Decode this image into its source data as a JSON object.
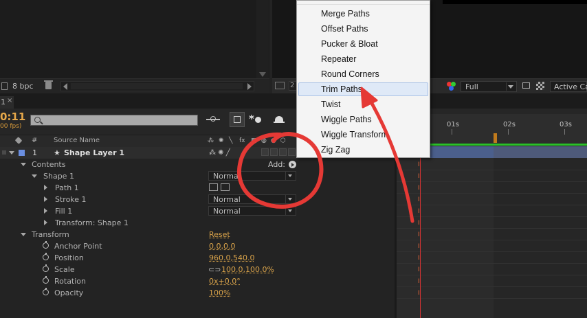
{
  "project": {
    "bpc_label": "8 bpc"
  },
  "viewer": {
    "zoom_label": "2",
    "resolution": "Full",
    "camera": "Active Cam"
  },
  "timeline": {
    "tab_label": "1",
    "timecode": "0:11",
    "fps": "00 fps)",
    "search_placeholder": "",
    "columns": {
      "number": "#",
      "source_name": "Source Name"
    },
    "ruler_ticks": [
      "01s",
      "02s",
      "03s"
    ]
  },
  "layers": {
    "shape_layer": {
      "number": "1",
      "name": "Shape Layer 1"
    },
    "contents_label": "Contents",
    "add_label": "Add:",
    "shape_group": {
      "label": "Shape 1",
      "mode": "Normal"
    },
    "path": {
      "label": "Path 1"
    },
    "stroke": {
      "label": "Stroke 1",
      "mode": "Normal"
    },
    "fill": {
      "label": "Fill 1",
      "mode": "Normal"
    },
    "transform_shape": {
      "label": "Transform: Shape 1"
    },
    "transform": {
      "label": "Transform",
      "reset": "Reset"
    },
    "properties": [
      {
        "label": "Anchor Point",
        "value": "0.0,0.0"
      },
      {
        "label": "Position",
        "value": "960.0,540.0"
      },
      {
        "label": "Scale",
        "value": "100.0,100.0%"
      },
      {
        "label": "Rotation",
        "value": "0x+0.0°"
      },
      {
        "label": "Opacity",
        "value": "100%"
      }
    ]
  },
  "add_menu": {
    "items": [
      "Merge Paths",
      "Offset Paths",
      "Pucker & Bloat",
      "Repeater",
      "Round Corners",
      "Trim Paths",
      "Twist",
      "Wiggle Paths",
      "Wiggle Transform",
      "Zig Zag"
    ],
    "highlighted": "Trim Paths"
  },
  "colors": {
    "annotation": "#e53935",
    "timecode": "#e8a94a",
    "label_blue": "#6a8ee0",
    "highlight": "#dfe9f7"
  }
}
